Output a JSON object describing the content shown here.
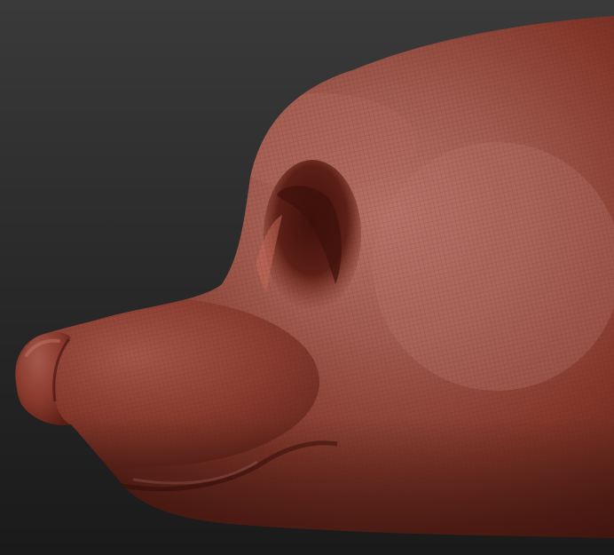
{
  "scene": {
    "subject": "sculpted-head",
    "colors": {
      "background_top": "#3a3a3a",
      "background_bottom": "#1a1a1a",
      "clay_base": "#8a3a2e",
      "clay_highlight": "#b46a5e",
      "clay_shadow": "#4a1a14",
      "wireframe": "#5c2219"
    }
  }
}
